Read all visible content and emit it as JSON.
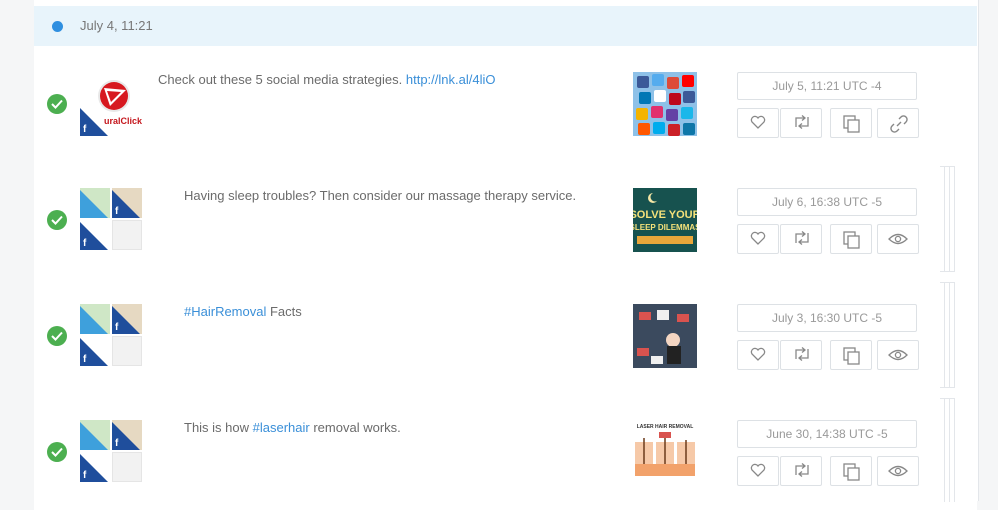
{
  "day_header": {
    "label": "July 4, 11:21"
  },
  "posts": [
    {
      "message_parts": [
        {
          "text": "Check out these 5 social media strategies. ",
          "type": "text"
        },
        {
          "text": "http://lnk.al/4liO",
          "type": "link"
        }
      ],
      "logo_text": "uralClick",
      "date": "July 5, 11:21 UTC -4",
      "last_action": "link"
    },
    {
      "message_parts": [
        {
          "text": "Having sleep troubles? Then consider our massage therapy service.",
          "type": "text"
        }
      ],
      "thumb_text": [
        "SOLVE YOUR",
        "SLEEP DILEMMAS"
      ],
      "date": "July 6, 16:38 UTC -5",
      "last_action": "preview"
    },
    {
      "message_parts": [
        {
          "text": "#HairRemoval",
          "type": "link"
        },
        {
          "text": " Facts",
          "type": "text"
        }
      ],
      "date": "July 3, 16:30 UTC -5",
      "last_action": "preview"
    },
    {
      "message_parts": [
        {
          "text": "This is how ",
          "type": "text"
        },
        {
          "text": "#laserhair",
          "type": "link"
        },
        {
          "text": " removal works.",
          "type": "text"
        }
      ],
      "thumb_text": [
        "LASER HAIR REMOVAL"
      ],
      "date": "June 30, 14:38 UTC -5",
      "last_action": "preview"
    }
  ],
  "colors": {
    "accent": "#3a8fd8",
    "success": "#4caf50",
    "facebook": "#1f4e9c",
    "twitter": "#3ea0dc",
    "header_bg": "#e8f4fb"
  }
}
